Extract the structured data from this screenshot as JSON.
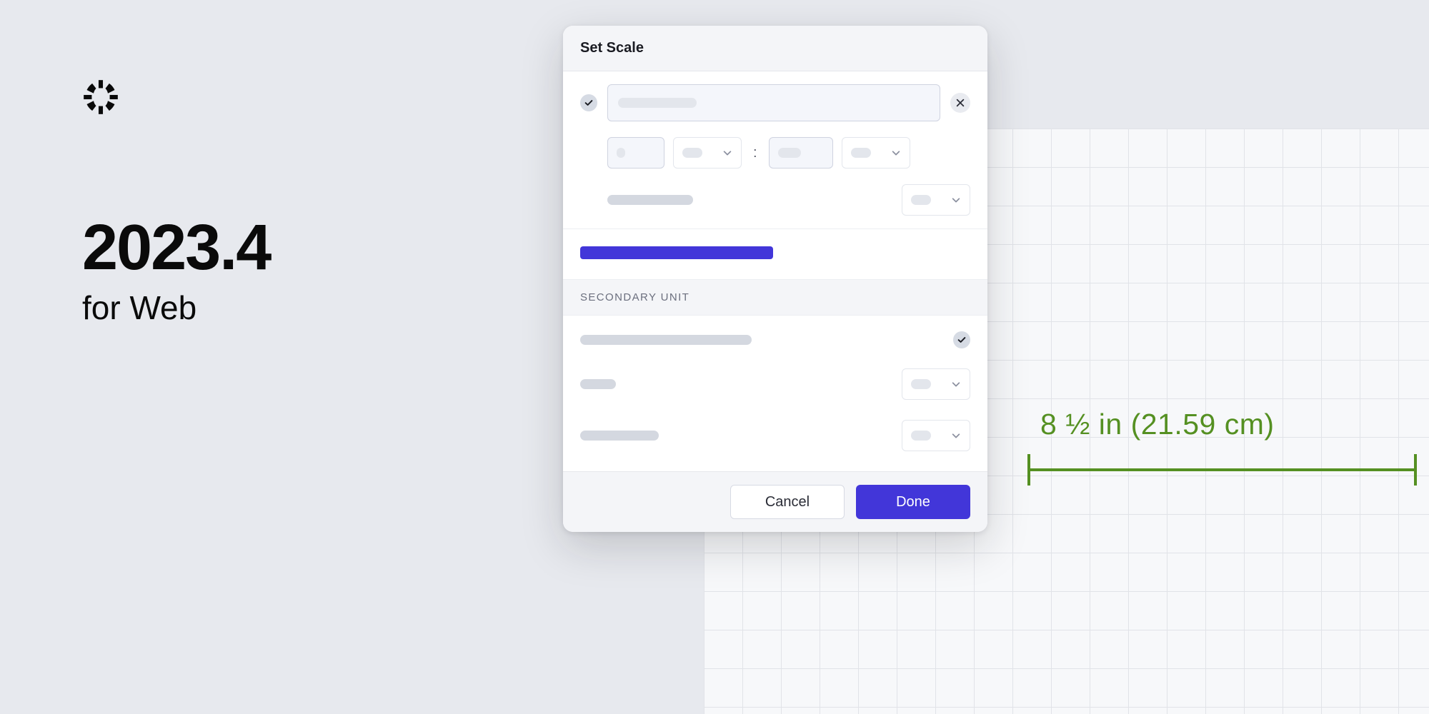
{
  "promo": {
    "version": "2023.4",
    "subtitle": "for Web"
  },
  "dialog": {
    "title": "Set Scale",
    "scale_checked": true,
    "ratio_separator": ":",
    "secondary_unit_label": "SECONDARY UNIT",
    "secondary_checked": true,
    "buttons": {
      "cancel": "Cancel",
      "done": "Done"
    }
  },
  "measurement": {
    "text": "8 ½ in (21.59 cm)"
  },
  "colors": {
    "accent": "#4236d9",
    "measure": "#559022"
  }
}
